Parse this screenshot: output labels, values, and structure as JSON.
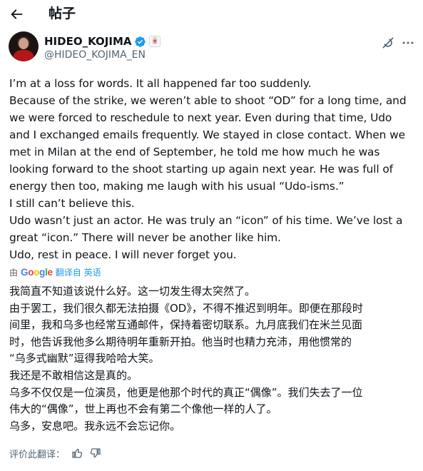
{
  "header": {
    "title": "帖子"
  },
  "author": {
    "display_name": "HIDEO_KOJIMA",
    "handle": "@HIDEO_KOJIMA_EN",
    "affiliate_badge": "🀄"
  },
  "post_lines": [
    "I’m at a loss for words. It all happened far too suddenly.",
    "Because of the strike, we weren’t able to shoot “OD” for a long time, and",
    "we were forced to reschedule to next year. Even during that time, Udo",
    "and I exchanged emails frequently. We stayed in close contact. When we",
    "met in Milan at the end of September, he told me how much he was",
    "looking forward to the shoot starting up again next year. He was full of",
    "energy then too, making me laugh with his usual “Udo-isms.”",
    "I still can’t believe this.",
    "Udo wasn’t just an actor. He was truly an “icon” of his time. We’ve lost a",
    "great “icon.” There will never be another like him.",
    "Udo, rest in peace. I will never forget you."
  ],
  "translation_meta": {
    "by_label": "由",
    "google_letters": [
      "G",
      "o",
      "o",
      "g",
      "l",
      "e"
    ],
    "google_colors": [
      "#4285f4",
      "#ea4335",
      "#fbbc05",
      "#4285f4",
      "#34a853",
      "#ea4335"
    ],
    "translated_from": "翻译自 英语"
  },
  "translation_lines": [
    "我简直不知道该说什么好。这一切发生得太突然了。",
    "由于罢工，我们很久都无法拍摄《OD》，不得不推迟到明年。即便在那段时",
    "间里，我和乌多也经常互通邮件，保持着密切联系。九月底我们在米兰见面",
    "时，他告诉我他多么期待明年重新开拍。他当时也精力充沛，用他惯常的",
    "“乌多式幽默”逗得我哈哈大笑。",
    "我还是不敢相信这是真的。",
    "乌多不仅仅是一位演员，他更是他那个时代的真正“偶像”。我们失去了一位",
    "伟大的“偶像”，世上再也不会有第二个像他一样的人了。",
    "乌多，安息吧。我永远不会忘记你。"
  ],
  "rating": {
    "label": "评价此翻译："
  },
  "colors": {
    "text": "#0f1419",
    "secondary": "#536471",
    "accent": "#1d9bf0"
  },
  "icons": [
    "back-arrow-icon",
    "verified-badge-icon",
    "grok-icon",
    "more-icon",
    "thumbs-up-icon",
    "thumbs-down-icon"
  ]
}
